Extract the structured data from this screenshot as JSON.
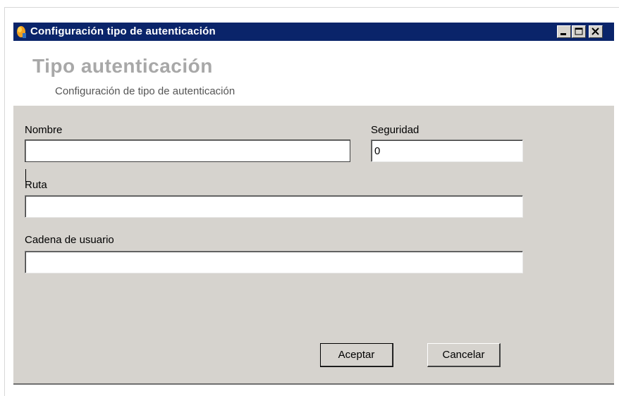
{
  "window": {
    "title": "Configuración tipo de autenticación",
    "controls": {
      "minimize": "minimize",
      "maximize": "maximize",
      "close": "close"
    }
  },
  "header": {
    "title": "Tipo autenticación",
    "subtitle": "Configuración de tipo de autenticación"
  },
  "form": {
    "nombre": {
      "label": "Nombre",
      "value": ""
    },
    "seguridad": {
      "label": "Seguridad",
      "value": "0"
    },
    "ruta": {
      "label": "Ruta",
      "value": ""
    },
    "cadena_usuario": {
      "label": "Cadena de usuario",
      "value": ""
    }
  },
  "buttons": {
    "accept": "Aceptar",
    "cancel": "Cancelar"
  },
  "colors": {
    "titlebar": "#0a246a",
    "window_bg": "#d6d3ce",
    "header_title": "#a8a8a8"
  },
  "icons": [
    "app-icon",
    "minimize-icon",
    "maximize-icon",
    "close-icon"
  ]
}
